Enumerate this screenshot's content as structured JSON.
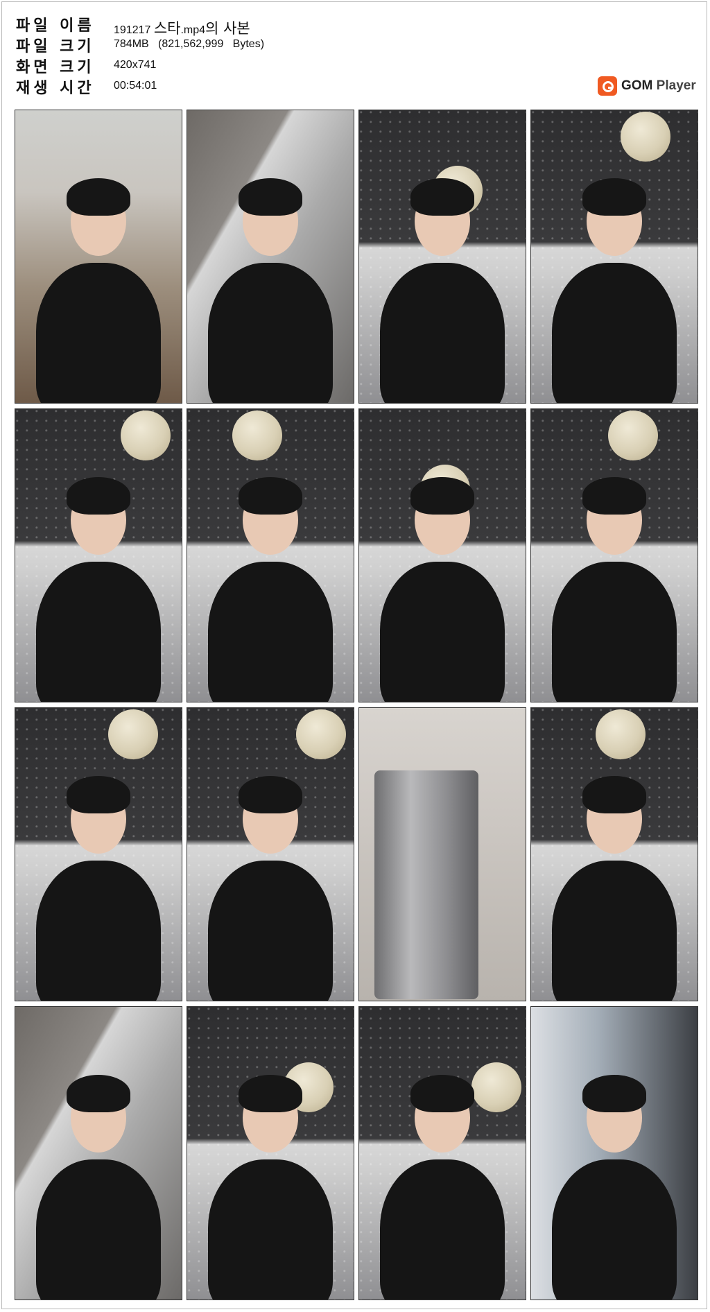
{
  "header": {
    "rows": [
      {
        "key": "파일 이름",
        "value_prefix": "191217 ",
        "value_korean": "스타",
        "value_mid": ".mp4",
        "value_suffix": "의 사본"
      },
      {
        "key": "파일 크기",
        "value": "784MB   (821,562,999   Bytes)"
      },
      {
        "key": "화면 크기",
        "value": "420x741"
      },
      {
        "key": "재생 시간",
        "value": "00:54:01"
      }
    ]
  },
  "logo": {
    "gom": "GOM",
    "player": " Player",
    "brand_color": "#f05a22"
  },
  "thumbnails": [
    {
      "scene": "kitchen"
    },
    {
      "scene": "wall"
    },
    {
      "scene": "star"
    },
    {
      "scene": "star"
    },
    {
      "scene": "star"
    },
    {
      "scene": "star"
    },
    {
      "scene": "star"
    },
    {
      "scene": "star"
    },
    {
      "scene": "star"
    },
    {
      "scene": "star"
    },
    {
      "scene": "fridge"
    },
    {
      "scene": "star"
    },
    {
      "scene": "wall"
    },
    {
      "scene": "star"
    },
    {
      "scene": "star"
    },
    {
      "scene": "city"
    }
  ]
}
